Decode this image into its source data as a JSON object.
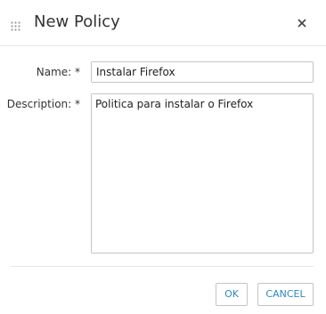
{
  "dialog": {
    "title": "New Policy",
    "drag_icon": "drag-grip-icon",
    "close_icon": "close-icon"
  },
  "form": {
    "name_label": "Name: *",
    "name_value": "Instalar Firefox",
    "description_label": "Description: *",
    "description_value": "Politica para instalar o Firefox"
  },
  "footer": {
    "ok_label": "OK",
    "cancel_label": "CANCEL"
  },
  "colors": {
    "button_text": "#2a8ac4",
    "border": "#c4c4c4",
    "divider": "#e6e6e6"
  }
}
